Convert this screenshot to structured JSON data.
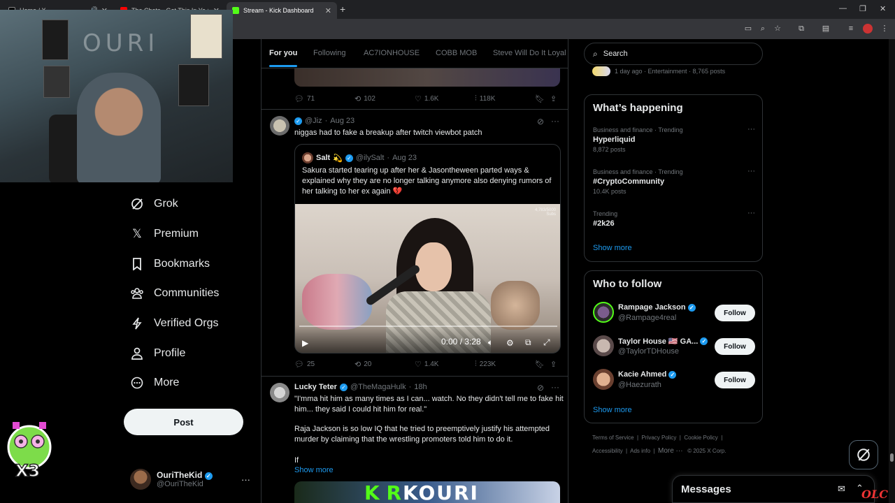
{
  "browser": {
    "tabs": [
      {
        "title": "Home / X",
        "active": false
      },
      {
        "title": "The Chats - Get This In Ya (Full",
        "active": false
      },
      {
        "title": "Stream - Kick Dashboard",
        "active": true
      }
    ],
    "new_tab": "+",
    "window_controls": [
      "—",
      "❐",
      "✕"
    ]
  },
  "webcam": {
    "wall_text": "OURI"
  },
  "nav": {
    "items": [
      {
        "label": "Grok",
        "icon": "grok-icon"
      },
      {
        "label": "Premium",
        "icon": "x-logo-icon"
      },
      {
        "label": "Bookmarks",
        "icon": "bookmark-icon"
      },
      {
        "label": "Communities",
        "icon": "communities-icon"
      },
      {
        "label": "Verified Orgs",
        "icon": "lightning-icon"
      },
      {
        "label": "Profile",
        "icon": "profile-icon"
      },
      {
        "label": "More",
        "icon": "more-circle-icon"
      }
    ],
    "post_label": "Post",
    "account": {
      "name": "OuriTheKid",
      "handle": "@OuriTheKid"
    }
  },
  "feed": {
    "tabs": [
      "For you",
      "Following",
      "AC7IONHOUSE",
      "COBB MOB",
      "Steve Will Do It Loyal"
    ],
    "prev_actions": {
      "replies": "71",
      "reposts": "102",
      "likes": "1.6K",
      "views": "118K"
    },
    "tweet1": {
      "handle": "@Jiz",
      "date": "Aug 23",
      "text": "niggas had to fake a breakup after twitch viewbot patch",
      "quote": {
        "name": "Salt",
        "emoji": "💫",
        "handle": "@ilySalt",
        "date": "Aug 23",
        "text": "Sakura started tearing up after her & Jasontheween parted ways & explained why they are no longer talking anymore also denying rumors of her talking to her ex again 💔",
        "video_time": "0:00 / 3:28",
        "overlay": "4,783/5000\nSubs"
      },
      "actions": {
        "replies": "25",
        "reposts": "20",
        "likes": "1.4K",
        "views": "223K"
      }
    },
    "tweet2": {
      "name": "Lucky Teter",
      "handle": "@TheMagaHulk",
      "date": "18h",
      "text1": "\"I'mma hit him as many times as I can... watch. No they didn't tell me to fake hit him... they said I could hit him for real.\"",
      "text2": "Raja Jackson is so low IQ that he tried to preemptively justify his attempted murder by claiming that the wrestling promoters told him to do it.",
      "text3": "If",
      "show_more": "Show more",
      "media_text_k": "K R",
      "media_text": "KOURI"
    }
  },
  "sidebar": {
    "search_placeholder": "Search",
    "top_trend_meta": "1 day ago · Entertainment · 8,765 posts",
    "whats_happening": {
      "title": "What’s happening",
      "trends": [
        {
          "category": "Business and finance · Trending",
          "name": "Hyperliquid",
          "posts": "8,872 posts"
        },
        {
          "category": "Business and finance · Trending",
          "name": "#CryptoCommunity",
          "posts": "10.4K posts"
        },
        {
          "category": "Trending",
          "name": "#2k26",
          "posts": ""
        }
      ],
      "show_more": "Show more"
    },
    "who_to_follow": {
      "title": "Who to follow",
      "people": [
        {
          "name": "Rampage Jackson",
          "handle": "@Rampage4real",
          "follow": "Follow"
        },
        {
          "name": "Taylor House 🇺🇸 GA...",
          "handle": "@TaylorTDHouse",
          "follow": "Follow"
        },
        {
          "name": "Kacie Ahmed",
          "handle": "@Haezurath",
          "follow": "Follow"
        }
      ],
      "show_more": "Show more"
    },
    "footer": {
      "line1": [
        "Terms of Service",
        "Privacy Policy",
        "Cookie Policy"
      ],
      "line2": [
        "Accessibility",
        "Ads info",
        "More ···",
        "© 2025 X Corp."
      ]
    },
    "messages_title": "Messages"
  },
  "watermark": "OLC",
  "colors": {
    "accent": "#1d9bf0",
    "kick_green": "#53fc18",
    "background": "#000000"
  }
}
